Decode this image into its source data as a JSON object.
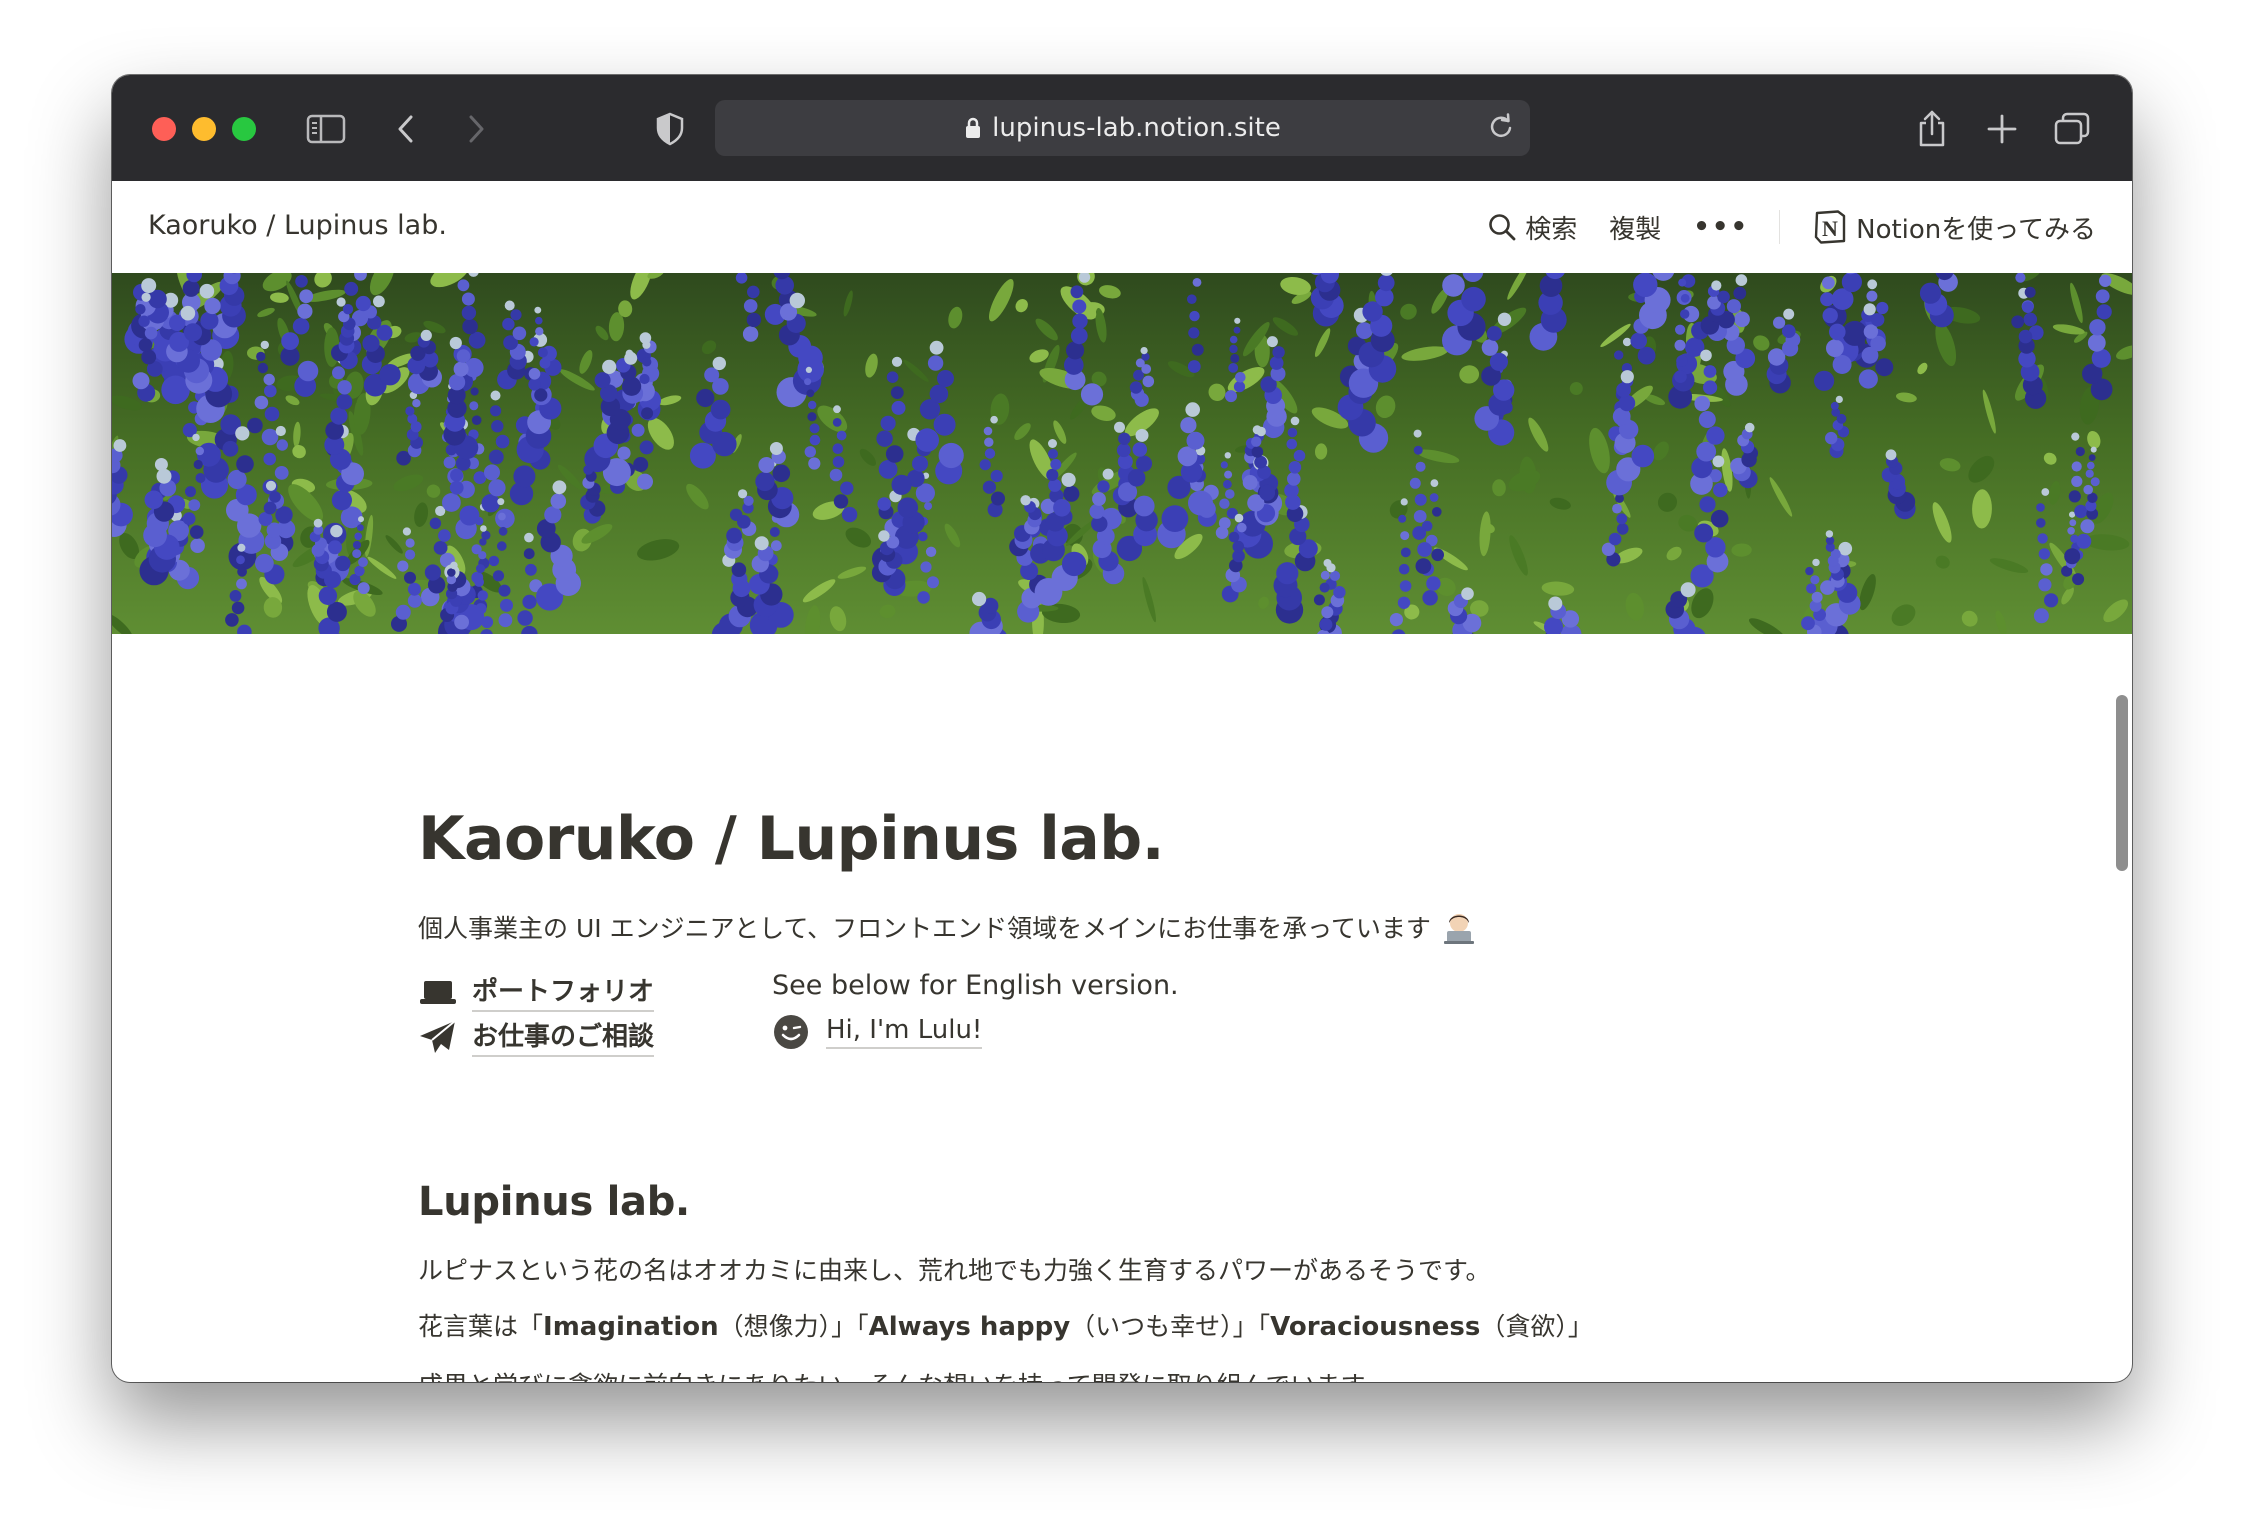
{
  "browser": {
    "url": "lupinus-lab.notion.site"
  },
  "topbar": {
    "breadcrumb": "Kaoruko / Lupinus lab.",
    "search_label": "検索",
    "duplicate_label": "複製",
    "more_label": "•••",
    "try_notion_label": "Notionを使ってみる"
  },
  "page": {
    "title": "Kaoruko / Lupinus lab.",
    "intro": "個人事業主の UI エンジニアとして、フロントエンド領域をメインにお仕事を承っています",
    "links_left": [
      {
        "label": "ポートフォリオ",
        "icon": "laptop-icon"
      },
      {
        "label": "お仕事のご相談",
        "icon": "paper-plane-icon"
      }
    ],
    "english_note": "See below for English version.",
    "english_link": {
      "label": "Hi, I'm Lulu!",
      "icon": "wink-face-icon"
    },
    "section_heading": "Lupinus lab.",
    "para1": "ルピナスという花の名はオオカミに由来し、荒れ地でも力強く生育するパワーがあるそうです。",
    "para2": {
      "prefix": "花言葉は「",
      "w1": "Imagination",
      "m1": "（想像力）」「",
      "w2": "Always happy",
      "m2": "（いつも幸せ）」「",
      "w3": "Voraciousness",
      "suffix": "（貪欲）」"
    },
    "para3": "成果と学びに貪欲に前向きにありたい、そんな想いを持って開発に取り組んでいます。"
  },
  "colors": {
    "titlebar": "#2b2b2e",
    "address_bar": "#3d3d41",
    "text": "#37352f",
    "lupine_blue": "#3b3fb5"
  }
}
